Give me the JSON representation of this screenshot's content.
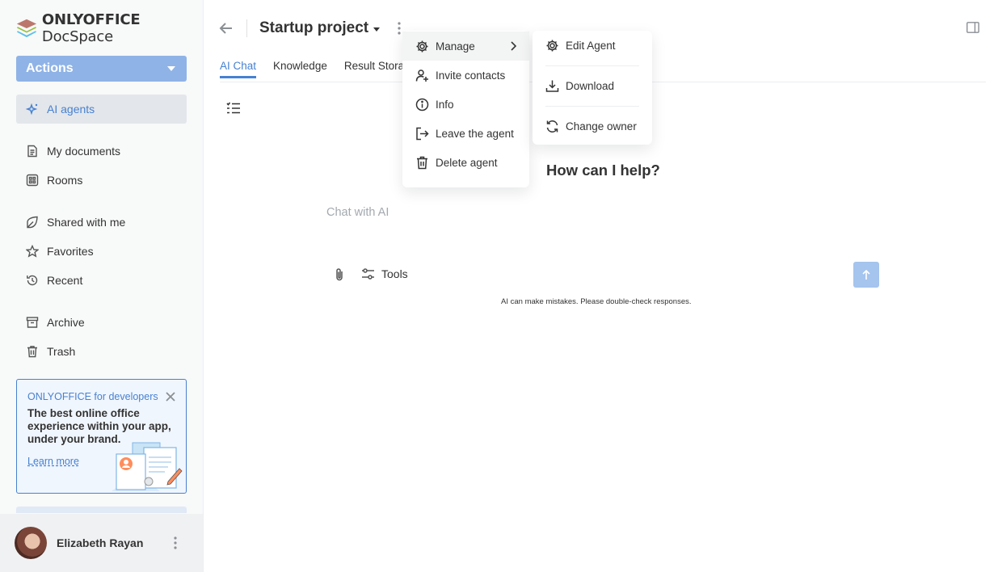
{
  "app": {
    "logo_brand": "ONLYOFFICE",
    "logo_product": "DocSpace",
    "actions_label": "Actions"
  },
  "sidebar": {
    "items": [
      {
        "label": "AI agents",
        "icon": "ai-sparkle-icon",
        "active": true
      },
      {
        "label": "My documents",
        "icon": "document-icon"
      },
      {
        "label": "Rooms",
        "icon": "rooms-grid-icon"
      },
      {
        "label": "Shared with me",
        "icon": "shared-icon"
      },
      {
        "label": "Favorites",
        "icon": "star-icon"
      },
      {
        "label": "Recent",
        "icon": "recent-clock-icon"
      },
      {
        "label": "Archive",
        "icon": "archive-icon"
      },
      {
        "label": "Trash",
        "icon": "trash-icon"
      }
    ],
    "promo": {
      "title": "ONLYOFFICE for developers",
      "text": "The best online office experience within your app, under your brand.",
      "link": "Learn more"
    },
    "user": {
      "name": "Elizabeth Rayan"
    }
  },
  "header": {
    "room_title": "Startup project",
    "tabs": [
      {
        "label": "AI Chat",
        "active": true
      },
      {
        "label": "Knowledge"
      },
      {
        "label": "Result Stora"
      }
    ]
  },
  "chat": {
    "heading": "How can I help?",
    "placeholder": "Chat with AI",
    "tools_label": "Tools",
    "disclaimer": "AI can make mistakes. Please double-check responses."
  },
  "context_menu": {
    "items": [
      {
        "label": "Manage",
        "icon": "gear-icon",
        "has_submenu": true
      },
      {
        "label": "Invite contacts",
        "icon": "invite-user-icon"
      },
      {
        "label": "Info",
        "icon": "info-icon"
      },
      {
        "label": "Leave the agent",
        "icon": "leave-icon"
      },
      {
        "label": "Delete agent",
        "icon": "trash-icon"
      }
    ]
  },
  "submenu": {
    "items": [
      {
        "label": "Edit Agent",
        "icon": "gear-icon"
      },
      {
        "label": "Download",
        "icon": "download-icon"
      },
      {
        "label": "Change owner",
        "icon": "change-owner-icon"
      }
    ]
  },
  "colors": {
    "accent": "#4781d1",
    "actions_button": "#8fb3e6",
    "send_button": "#a5c4ee",
    "sidebar_bg": "#f8f9f9"
  }
}
